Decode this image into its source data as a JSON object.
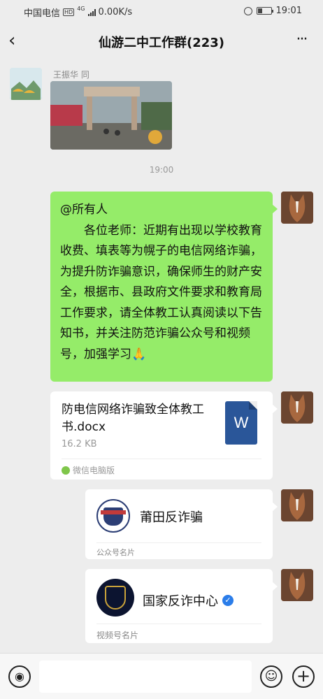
{
  "status_bar": {
    "carrier": "中国电信",
    "hd": "HD",
    "network": "4G",
    "speed": "0.00K/s",
    "time": "19:01",
    "battery_level": 0.35,
    "icons": [
      "hd-icon",
      "signal-icon",
      "alarm-icon",
      "battery-icon"
    ]
  },
  "header": {
    "back_icon": "chevron-left-icon",
    "title": "仙游二中工作群(223)",
    "more_icon": "more-dots-icon",
    "back_glyph": "‹",
    "more_glyph": "···"
  },
  "messages": {
    "first": {
      "sender": "王振华 同",
      "avatar": "boats-avatar",
      "content": "photo"
    },
    "timestamp": "19:00",
    "text_message": {
      "mention": "@所有人",
      "body": "各位老师：近期有出现以学校教育收费、填表等为幌子的电信网络诈骗，为提升防诈骗意识，确保师生的财产安全，根据市、县政府文件要求和教育局工作要求，请全体教工认真阅读以下告知书，并关注防范诈骗公众号和视频号，加强学习🙏",
      "bubble_color": "#95ec69"
    },
    "file_message": {
      "file_name": "防电信网络诈骗致全体教工书.docx",
      "file_size": "16.2 KB",
      "source": "微信电脑版",
      "file_icon_letter": "W"
    },
    "official_account_card": {
      "name": "莆田反诈骗",
      "label": "公众号名片"
    },
    "channel_card": {
      "name": "国家反诈中心",
      "label": "视频号名片",
      "verified_glyph": "✓"
    }
  },
  "input_bar": {
    "voice_glyph": "◉",
    "emoji_glyph": "☺",
    "plus_glyph": "+",
    "placeholder": ""
  },
  "colors": {
    "background": "#ededed",
    "accent_green": "#95ec69",
    "word_blue": "#2a5699",
    "verified_blue": "#2b7de9"
  }
}
